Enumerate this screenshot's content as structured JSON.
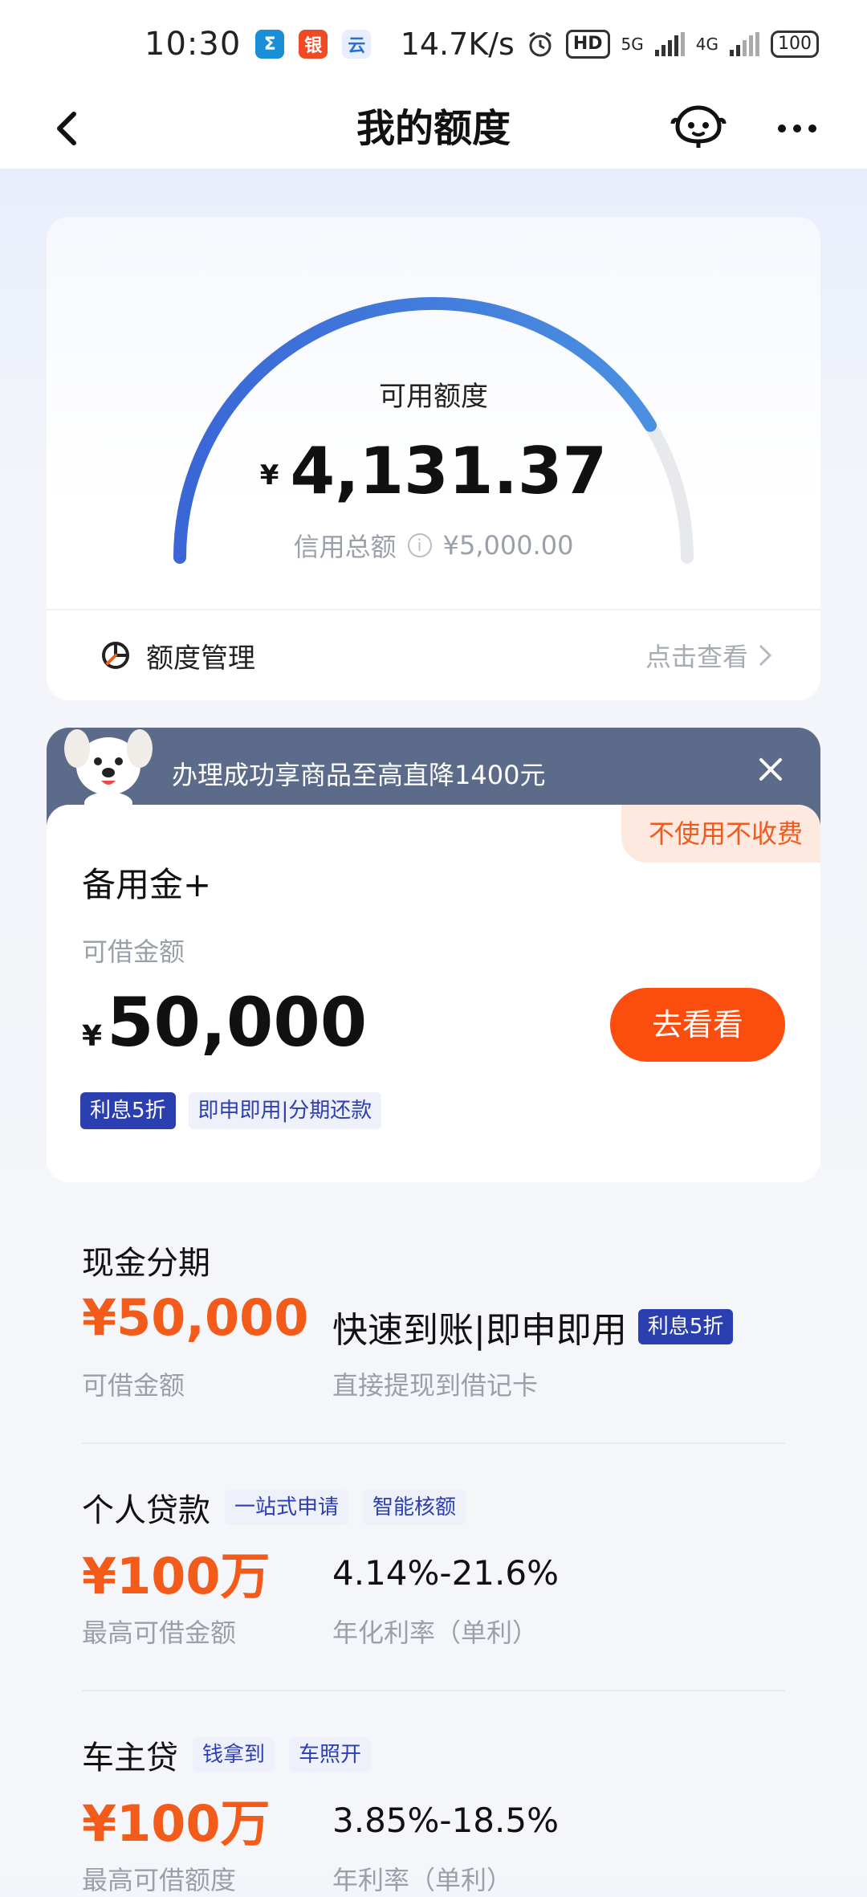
{
  "status_bar": {
    "time": "10:30",
    "net_speed": "14.7K/s",
    "hd_label": "HD",
    "signal_5g": "5G",
    "signal_4g": "4G",
    "battery": "100"
  },
  "nav": {
    "title": "我的额度"
  },
  "credit": {
    "label": "可用额度",
    "currency": "¥",
    "available": "4,131.37",
    "total_label": "信用总额",
    "total_value": "¥5,000.00",
    "available_fraction": 0.826,
    "manage_label": "额度管理",
    "manage_link": "点击查看"
  },
  "promo": {
    "banner_text": "办理成功享商品至高直降1400元",
    "badge": "不使用不收费",
    "title": "备用金+",
    "sub_label": "可借金额",
    "currency": "¥",
    "amount": "50,000",
    "button": "去看看",
    "tags": [
      "利息5折",
      "即申即用|分期还款"
    ]
  },
  "products": [
    {
      "name": "现金分期",
      "tags": [],
      "amount": "¥50,000",
      "amount_label": "可借金额",
      "headline": "快速到账|即申即用",
      "headline_tag": "利息5折",
      "desc": "直接提现到借记卡"
    },
    {
      "name": "个人贷款",
      "tags": [
        "一站式申请",
        "智能核额"
      ],
      "amount": "¥100万",
      "amount_label": "最高可借金额",
      "rate": "4.14%-21.6%",
      "desc": "年化利率（单利）"
    },
    {
      "name": "车主贷",
      "tags": [
        "钱拿到",
        "车照开"
      ],
      "amount": "¥100万",
      "amount_label": "最高可借额度",
      "rate": "3.85%-18.5%",
      "desc": "年利率（单利）"
    }
  ],
  "colors": {
    "accent_orange": "#fa4d0e",
    "gauge_blue": "#3f72d8",
    "tag_blue": "#2c3fb1"
  }
}
